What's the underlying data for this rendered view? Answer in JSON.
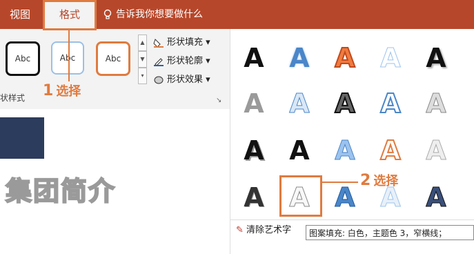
{
  "ribbon": {
    "tabs": [
      {
        "label": "视图"
      },
      {
        "label": "格式"
      }
    ],
    "tell_me": "告诉我你想要做什么"
  },
  "shape_styles": {
    "thumbs": [
      "Abc",
      "Abc",
      "Abc"
    ],
    "group_label": "状样式",
    "fill": "形状填充",
    "outline": "形状轮廓",
    "effects": "形状效果"
  },
  "slide": {
    "title": "集团简介"
  },
  "wordart_gallery": {
    "glyph": "A",
    "clear_label": "清除艺术字",
    "tooltip": "图案填充: 白色，主题色 3，窄横线；"
  },
  "annotations": {
    "step1": {
      "num": "1",
      "text": "选择"
    },
    "step2": {
      "num": "2",
      "text": "选择"
    }
  },
  "colors": {
    "ribbon": "#b7472a",
    "accent": "#e07b3f",
    "navy": "#2c3c5c"
  }
}
